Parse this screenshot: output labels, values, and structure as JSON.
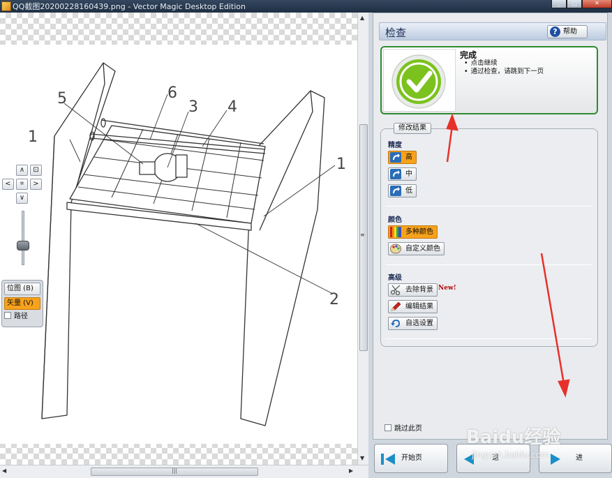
{
  "window": {
    "title": "QQ截图20200228160439.png - Vector Magic Desktop Edition"
  },
  "drawing": {
    "labels": [
      "1",
      "5",
      "6",
      "3",
      "4",
      "1",
      "2"
    ]
  },
  "left_tools": {
    "nav": {
      "up": "∧",
      "down": "∨",
      "left": "<",
      "right": ">",
      "fit": "⌗",
      "zoom_box": "⊡"
    },
    "view_modes": [
      {
        "label": "位图 (B)",
        "selected": false
      },
      {
        "label": "矢量 (V)",
        "selected": true
      }
    ],
    "path_label": "路径"
  },
  "wizard": {
    "title": "检查",
    "help_label": "帮助",
    "status": {
      "title": "完成",
      "bullets": [
        "点击继续",
        "通过检查，请跳到下一页"
      ]
    },
    "results_tab": "修改结果",
    "precision": {
      "title": "精度",
      "options": [
        "高",
        "中",
        "低"
      ],
      "selected_index": 0
    },
    "color": {
      "title": "颜色",
      "options": [
        "多种颜色",
        "自定义颜色"
      ],
      "selected_index": 0
    },
    "advanced": {
      "title": "高级",
      "options": [
        "去除背景",
        "编辑结果",
        "自选设置"
      ],
      "new_badge": "New!"
    },
    "skip_label": "跳过此页"
  },
  "footer": {
    "start_label": "开始页",
    "back_label": "退",
    "next_label": "进"
  },
  "watermark": {
    "brand": "Baidu经验",
    "url": "jingyan.baidu.com"
  },
  "colors": {
    "accent": "#f7a21c",
    "done_border": "#2e8b2e",
    "annotation_arrow": "#e8302a"
  }
}
